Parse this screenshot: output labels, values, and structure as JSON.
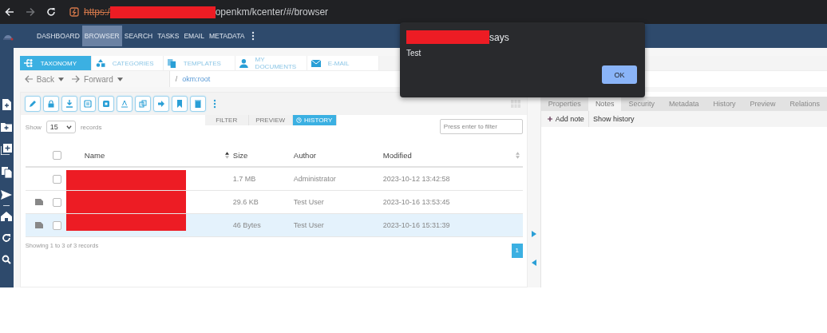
{
  "browser": {
    "url_scheme": "https:/",
    "url_path": "openkm/kcenter/#/browser"
  },
  "top_nav": [
    {
      "label": "DASHBOARD",
      "selected": false
    },
    {
      "label": "BROWSER",
      "selected": true
    },
    {
      "label": "SEARCH",
      "selected": false
    },
    {
      "label": "TASKS",
      "selected": false
    },
    {
      "label": "EMAIL",
      "selected": false
    },
    {
      "label": "METADATA",
      "selected": false
    }
  ],
  "panel_tabs": [
    {
      "label": "TAXONOMY",
      "selected": true
    },
    {
      "label": "CATEGORIES",
      "selected": false
    },
    {
      "label": "TEMPLATES",
      "selected": false
    },
    {
      "label": "MY DOCUMENTS",
      "selected": false
    },
    {
      "label": "E-MAIL",
      "selected": false
    }
  ],
  "navigation": {
    "back": "Back",
    "forward": "Forward",
    "separator": "/",
    "path": "okm:root"
  },
  "view_tabs": [
    {
      "label": "FILTER",
      "selected": false
    },
    {
      "label": "PREVIEW",
      "selected": false
    },
    {
      "label": "HISTORY",
      "selected": true
    }
  ],
  "page_size": {
    "before": "Show",
    "value": "15",
    "after": "records"
  },
  "filter": {
    "placeholder": "Press enter to filter"
  },
  "table": {
    "select_all_checked": false,
    "columns": [
      {
        "label": "Name",
        "kind": "plain"
      },
      {
        "label": "Size",
        "kind": "sorted"
      },
      {
        "label": "Author",
        "kind": "plain"
      },
      {
        "label": "Modified",
        "kind": "sortable"
      }
    ],
    "rows": [
      {
        "has_note": false,
        "checked": false,
        "selected": false,
        "size": "1.7 MB",
        "author": "Administrator",
        "modified": "2023-10-12 13:42:58"
      },
      {
        "has_note": true,
        "checked": false,
        "selected": false,
        "size": "29.6 KB",
        "author": "Test User",
        "modified": "2023-10-16 13:53:45"
      },
      {
        "has_note": true,
        "checked": false,
        "selected": true,
        "size": "46 Bytes",
        "author": "Test User",
        "modified": "2023-10-16 15:31:39"
      }
    ]
  },
  "footer": "Showing 1 to 3 of 3 records",
  "pagination": [
    {
      "label": "1",
      "selected": true
    }
  ],
  "details_tabs": [
    {
      "label": "Properties",
      "selected": false
    },
    {
      "label": "Notes",
      "selected": true
    },
    {
      "label": "Security",
      "selected": false
    },
    {
      "label": "Metadata",
      "selected": false
    },
    {
      "label": "History",
      "selected": false
    },
    {
      "label": "Preview",
      "selected": false
    },
    {
      "label": "Relations",
      "selected": false
    }
  ],
  "notes_toolbar": {
    "add": "Add note",
    "history": "Show history"
  },
  "dialog": {
    "title_suffix": "says",
    "message": "Test",
    "button": "OK"
  }
}
